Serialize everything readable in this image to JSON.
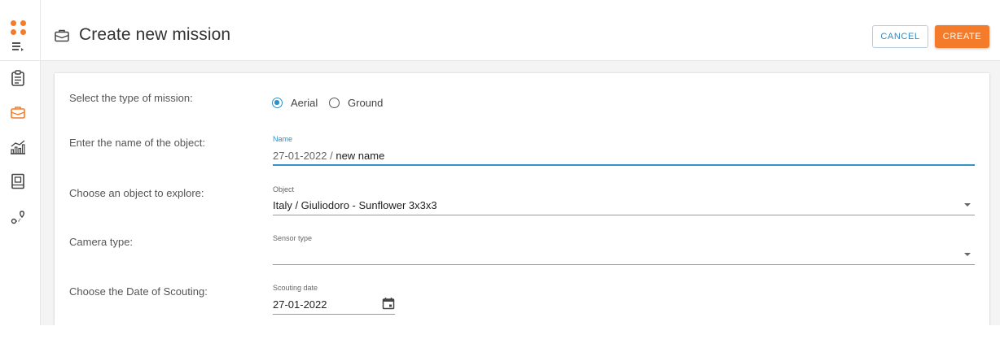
{
  "header": {
    "title": "Create new mission",
    "cancel_label": "CANCEL",
    "create_label": "CREATE"
  },
  "sidebar": {
    "items": [
      {
        "icon": "clipboard-icon"
      },
      {
        "icon": "briefcase-icon",
        "active": true
      },
      {
        "icon": "analytics-chart-icon"
      },
      {
        "icon": "report-book-icon"
      },
      {
        "icon": "route-map-icon"
      }
    ]
  },
  "form": {
    "mission_type": {
      "label": "Select the type of mission:",
      "options": [
        "Aerial",
        "Ground"
      ],
      "selected": "Aerial"
    },
    "name": {
      "label": "Enter the name of the object:",
      "field_label": "Name",
      "prefix": "27-01-2022 / ",
      "value": "new name"
    },
    "object": {
      "label": "Choose an object to explore:",
      "field_label": "Object",
      "value": "Italy / Giuliodoro - Sunflower 3x3x3"
    },
    "camera": {
      "label": "Camera type:",
      "field_label": "Sensor type",
      "value": ""
    },
    "date": {
      "label": "Choose the Date of Scouting:",
      "field_label": "Scouting date",
      "value": "27-01-2022"
    }
  },
  "colors": {
    "accent": "#f47b2a",
    "primary": "#2f8fc6"
  }
}
